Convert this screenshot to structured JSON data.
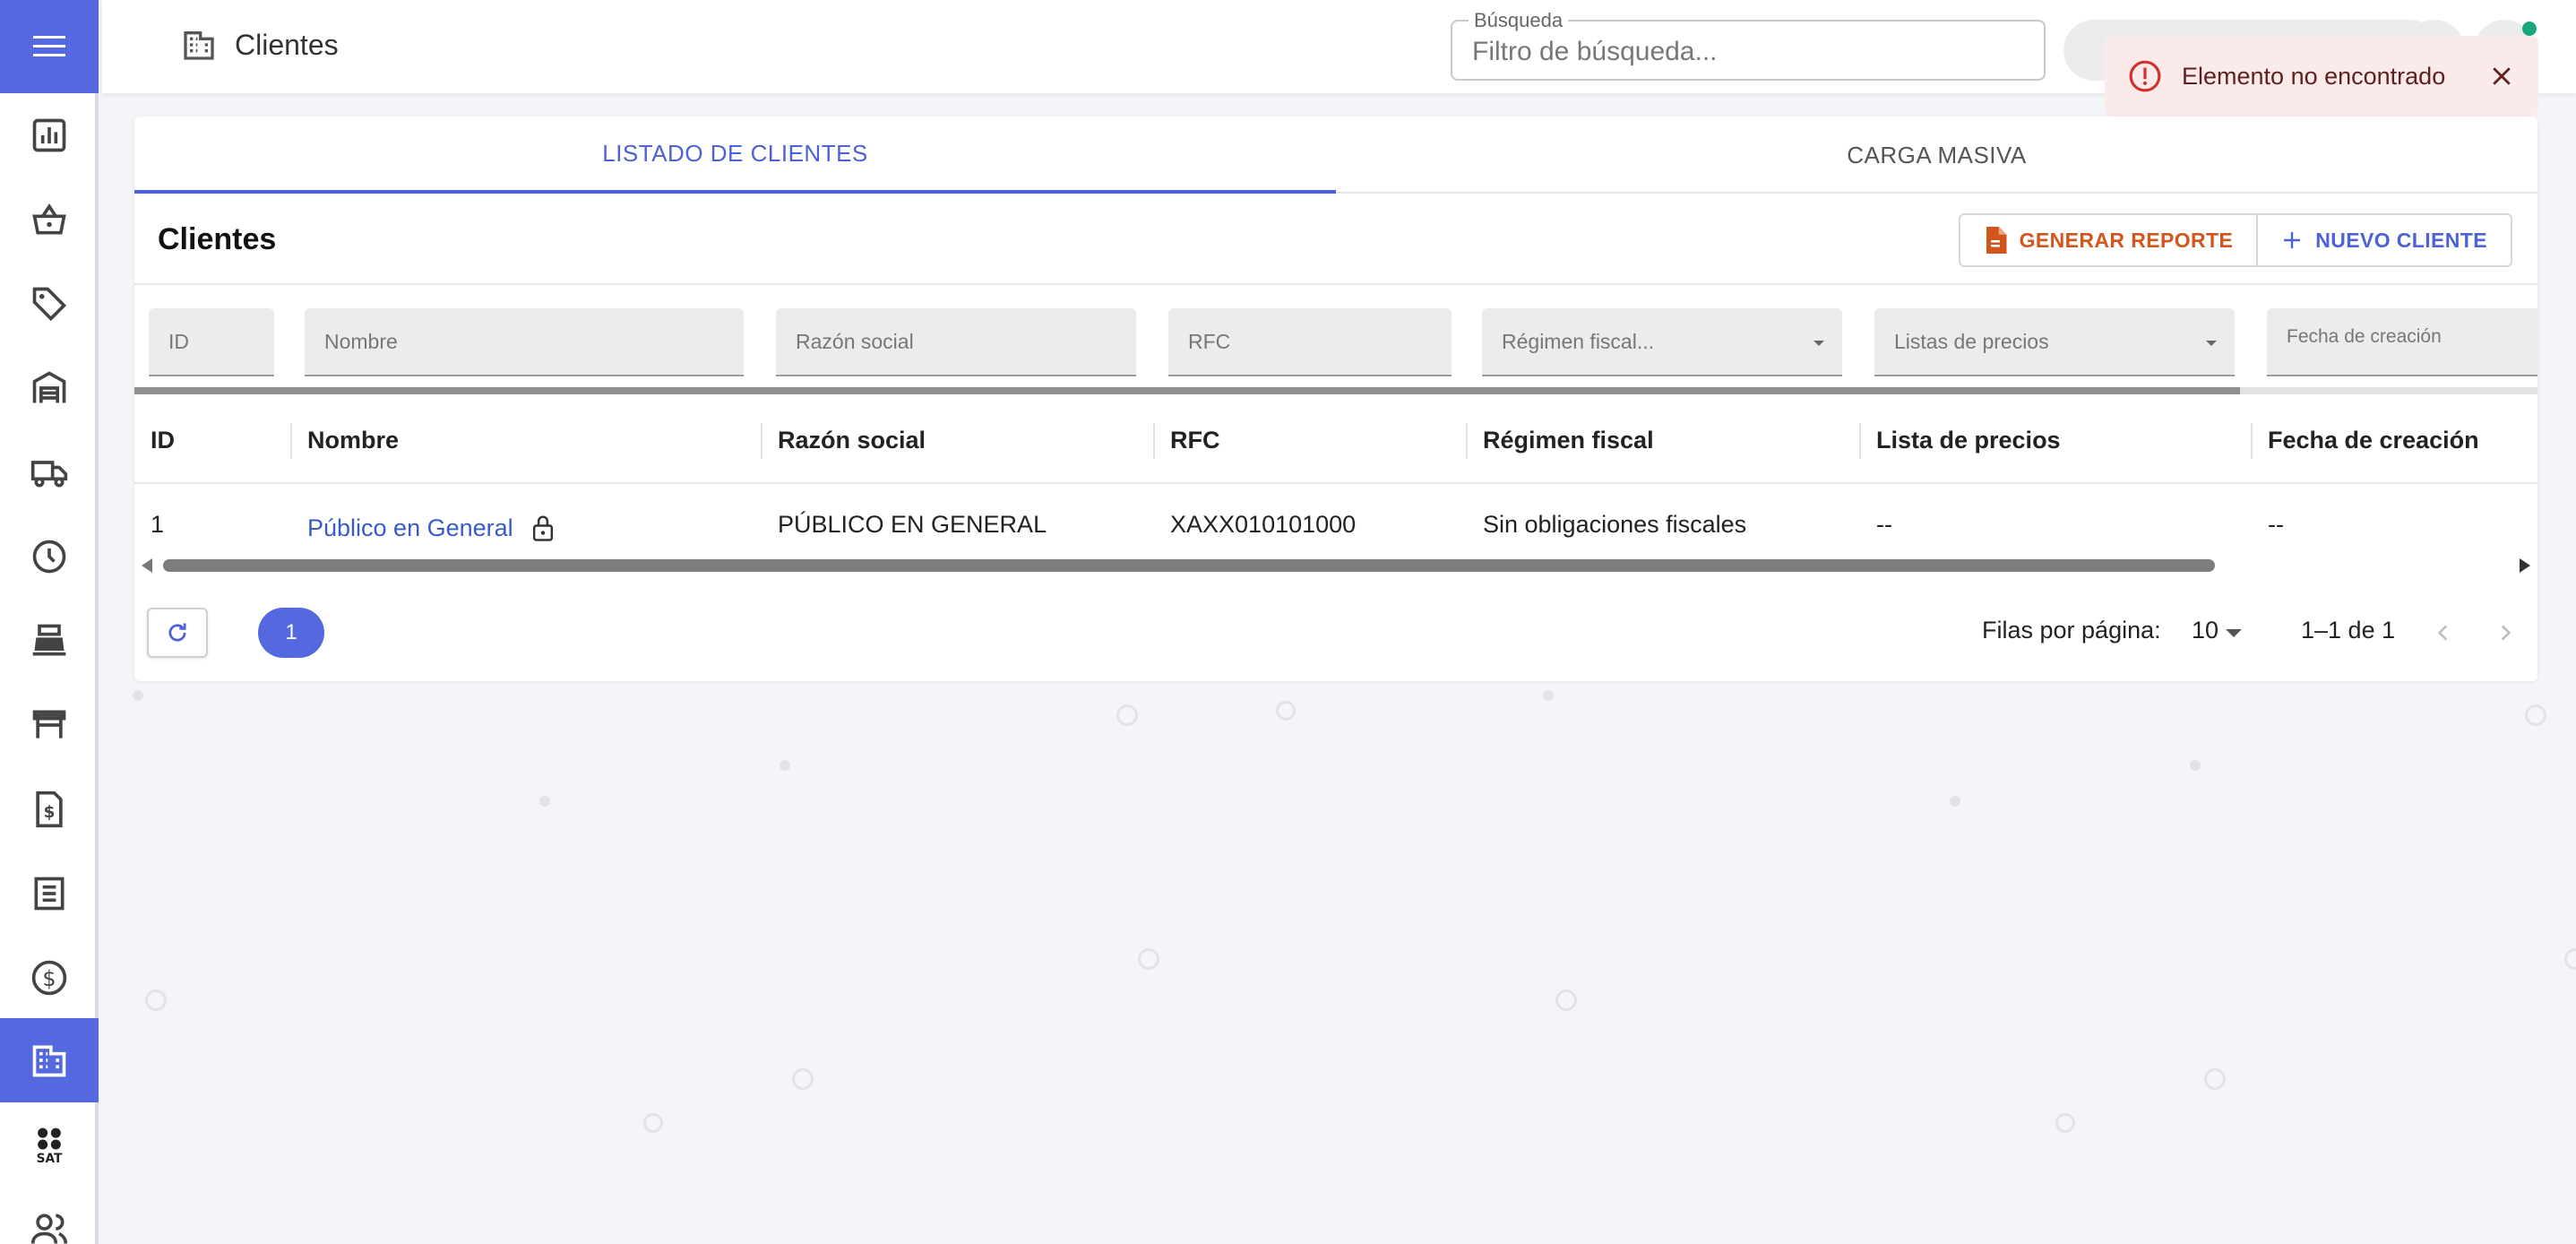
{
  "header": {
    "title": "Clientes",
    "search_label": "Búsqueda",
    "search_placeholder": "Filtro de búsqueda..."
  },
  "toast": {
    "message": "Elemento no encontrado",
    "color": "#fbeaea"
  },
  "sidebar": {
    "accent": "#5468e0",
    "items": [
      {
        "icon": "bar-chart-icon"
      },
      {
        "icon": "shopping-basket-icon"
      },
      {
        "icon": "tag-icon"
      },
      {
        "icon": "warehouse-icon"
      },
      {
        "icon": "truck-icon"
      },
      {
        "icon": "clock-icon"
      },
      {
        "icon": "cash-register-icon"
      },
      {
        "icon": "table-icon"
      },
      {
        "icon": "invoice-icon"
      },
      {
        "icon": "receipt-icon"
      },
      {
        "icon": "dollar-icon"
      },
      {
        "icon": "building-icon",
        "active": true
      },
      {
        "icon": "sat-icon",
        "label": "SAT"
      },
      {
        "icon": "users-icon"
      }
    ]
  },
  "tabs": [
    {
      "label": "LISTADO DE CLIENTES",
      "active": true
    },
    {
      "label": "CARGA MASIVA",
      "active": false
    }
  ],
  "card": {
    "title": "Clientes",
    "report_button": "GENERAR REPORTE",
    "new_button": "NUEVO CLIENTE"
  },
  "filters": {
    "id": "ID",
    "nombre": "Nombre",
    "razon": "Razón social",
    "rfc": "RFC",
    "regimen": "Régimen fiscal...",
    "listas": "Listas de precios",
    "fecha": "Fecha de creación"
  },
  "table": {
    "columns": [
      "ID",
      "Nombre",
      "Razón social",
      "RFC",
      "Régimen fiscal",
      "Lista de precios",
      "Fecha de creación"
    ],
    "rows": [
      {
        "id": "1",
        "nombre": "Público en General",
        "razon": "PÚBLICO EN GENERAL",
        "rfc": "XAXX010101000",
        "regimen": "Sin obligaciones fiscales",
        "lista": "--",
        "fecha": "--"
      }
    ]
  },
  "pagination": {
    "current_page": "1",
    "rows_label": "Filas por página:",
    "rows_value": "10",
    "range": "1–1 de 1"
  }
}
